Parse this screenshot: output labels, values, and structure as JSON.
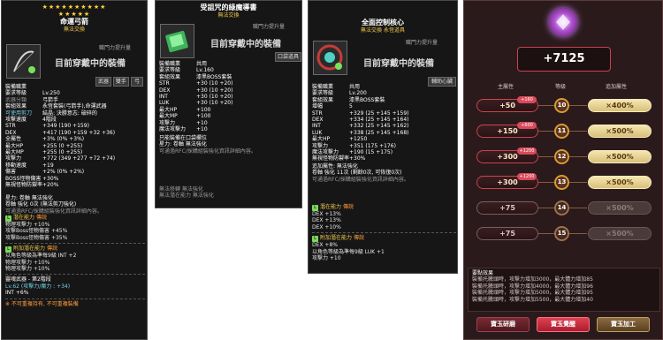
{
  "t1": {
    "stars_top": "★★★★★★★★★★",
    "stars_bot": "★★★★★",
    "name": "命運弓箭",
    "sub": "無法交換",
    "job_label": "職門力提升量",
    "equipped_msg": "目前穿戴中的裝備",
    "tags": [
      "武器",
      "雙手",
      "弓"
    ],
    "lines": [
      [
        "w",
        "裝備職業"
      ],
      [
        "w",
        "要求等級",
        "Lv.250"
      ],
      [
        "gr",
        "武器分類",
        "弓箭手"
      ],
      [
        "w",
        "套組效果",
        "永恆套裝(弓箭手),命運武器"
      ],
      [
        "c",
        "可使用剪刀",
        "結晶: 決勝意志: 破碎的"
      ],
      [
        "w",
        "攻擊速度",
        "4階段"
      ],
      [
        "w",
        "STR",
        "+349 (190 +159)"
      ],
      [
        "w",
        "DEX",
        "+417 (190 +159 +32 +36)"
      ],
      [
        "w",
        "全屬性",
        "+3% (0% +3%)"
      ],
      [
        "w",
        "最大HP",
        "+255 (0 +255)"
      ],
      [
        "w",
        "最大MP",
        "+255 (0 +255)"
      ],
      [
        "w",
        "攻擊力",
        "+772 (349 +277 +72 +74)"
      ],
      [
        "w",
        "移動速度",
        "+19"
      ],
      [
        "w",
        "傷害",
        "+2% (0% +2%)"
      ],
      [
        "w",
        "BOSS怪物傷害",
        "+30%"
      ],
      [
        "w",
        "無視怪物防禦率",
        "+20%"
      ]
    ],
    "lines2": [
      [
        "w",
        "星力: 卷軸 無法強化"
      ],
      [
        "w",
        "卷軸 強化 0次 (無法剪刀強化)"
      ],
      [
        "gr",
        "可通過RFC/採購組裝強化資訊詳細內容。"
      ]
    ],
    "pot_title": "潛在能力",
    "pot_grade": "傳說",
    "pot": [
      "物理攻擊力 +10%",
      "攻擊Boss怪物傷害 +45%",
      "攻擊Boss怪物傷害 +35%"
    ],
    "addpot_title": "附加潛在能力",
    "addpot_grade": "傳說",
    "addpot": [
      "以角色等級為準每9級 INT +2",
      "物理攻擊力 +10%",
      "物理攻擊力 +10%"
    ],
    "soul": [
      "靈魂武器 - 第2階段",
      "Lv.62 (攻擊力/魔力 : +34)",
      "INT +6%"
    ],
    "footer": "※ 不可重複持有, 不可重複裝備"
  },
  "t2": {
    "name": "受詛咒的綠魔導書",
    "sub": "無法交換",
    "job_label": "職門力提升量",
    "equipped_msg": "目前穿戴中的裝備",
    "tag": "口袋道具",
    "lines": [
      [
        "w",
        "裝備職業",
        "共用"
      ],
      [
        "w",
        "要求等級",
        "Lv.160"
      ],
      [
        "w",
        "套組效果",
        "漆黑BOSS套裝"
      ],
      [
        "w",
        "STR",
        "+30 (10 +20)"
      ],
      [
        "w",
        "DEX",
        "+30 (10 +20)"
      ],
      [
        "w",
        "INT",
        "+30 (10 +20)"
      ],
      [
        "w",
        "LUK",
        "+30 (10 +20)"
      ],
      [
        "w",
        "最大HP",
        "+100"
      ],
      [
        "w",
        "最大MP",
        "+100"
      ],
      [
        "w",
        "攻擊力",
        "+10"
      ],
      [
        "w",
        "魔法攻擊力",
        "+10"
      ]
    ],
    "lines2": [
      [
        "w",
        "只能裝備在口袋欄位"
      ],
      [
        "w",
        "星力: 卷軸 無法強化"
      ],
      [
        "gr",
        "可通過RFC/採購組裝強化資訊詳細內容。"
      ]
    ],
    "flags": [
      "無法移轉 無法強化",
      "無法潛在能力 無法強化"
    ]
  },
  "t3": {
    "name": "全面控制核心",
    "sub": "無法交換  永恆道具",
    "job_label": "職門力提升量",
    "equipped_msg": "目前穿戴中的裝備",
    "tag": "輔助心臟",
    "lines": [
      [
        "w",
        "裝備職業",
        "共用"
      ],
      [
        "w",
        "要求等級",
        "Lv.200"
      ],
      [
        "w",
        "套組效果",
        "漆黑BOSS套裝"
      ],
      [
        "w",
        "增幅",
        "5"
      ],
      [
        "w",
        "STR",
        "+329 (25 +145 +159)"
      ],
      [
        "w",
        "DEX",
        "+334 (25 +145 +164)"
      ],
      [
        "w",
        "INT",
        "+332 (25 +145 +162)"
      ],
      [
        "w",
        "LUK",
        "+338 (25 +145 +168)"
      ],
      [
        "w",
        "最大HP",
        "+1250"
      ],
      [
        "w",
        "攻擊力",
        "+351 (175 +176)"
      ],
      [
        "w",
        "魔法攻擊力",
        "+190 (15 +175)"
      ],
      [
        "w",
        "無視怪物防禦率",
        "+30%"
      ]
    ],
    "lines2": [
      [
        "w",
        "追加屬性: 無法強化"
      ],
      [
        "w",
        "卷軸 強化 11次 (剩餘0次, 可恢復0次)"
      ],
      [
        "gr",
        "可通過RFC/採購組裝強化資訊詳細內容。"
      ]
    ],
    "pot_title": "潛在能力",
    "pot_grade": "傳說",
    "pot": [
      "DEX +13%",
      "DEX +13%",
      "DEX +10%"
    ],
    "addpot_title": "附加潛在能力",
    "addpot_grade": "傳說",
    "addpot": [
      "DEX +8%",
      "以角色等級為準每9級 LUK +1",
      "攻擊力 +10"
    ]
  },
  "panel": {
    "value": "+7125",
    "cols": [
      "主屬性",
      "等級",
      "追加屬性"
    ],
    "rows": [
      {
        "val": "+50",
        "badge": "+160",
        "lvl": "10",
        "mult": "×400%",
        "on": true
      },
      {
        "val": "+150",
        "badge": "+600",
        "lvl": "11",
        "mult": "×500%",
        "on": true
      },
      {
        "val": "+300",
        "badge": "+1200",
        "lvl": "12",
        "mult": "×500%",
        "on": true
      },
      {
        "val": "+300",
        "badge": "+1200",
        "lvl": "13",
        "mult": "×500%",
        "on": true
      },
      {
        "val": "+75",
        "badge": "",
        "lvl": "14",
        "mult": "×500%",
        "on": false
      },
      {
        "val": "+75",
        "badge": "",
        "lvl": "15",
        "mult": "×500%",
        "on": false
      }
    ],
    "eff_title": "要點效果",
    "effects": [
      "裝備托騰頭時，攻擊力增加3000，最大體力增加85",
      "裝備托騰頭時，攻擊力增加4000，最大體力增加96",
      "裝備托騰頭時，攻擊力增加5000，最大體力增加95",
      "裝備托騰頭時，攻擊力增加5500，最大體力增加40"
    ],
    "btn1": "寶玉研磨",
    "btn2": "寶玉覺醒",
    "btn3": "寶玉加工"
  },
  "colors": {
    "accent": "#c9444e",
    "gold": "#f0c94a",
    "green": "#7ed957"
  }
}
